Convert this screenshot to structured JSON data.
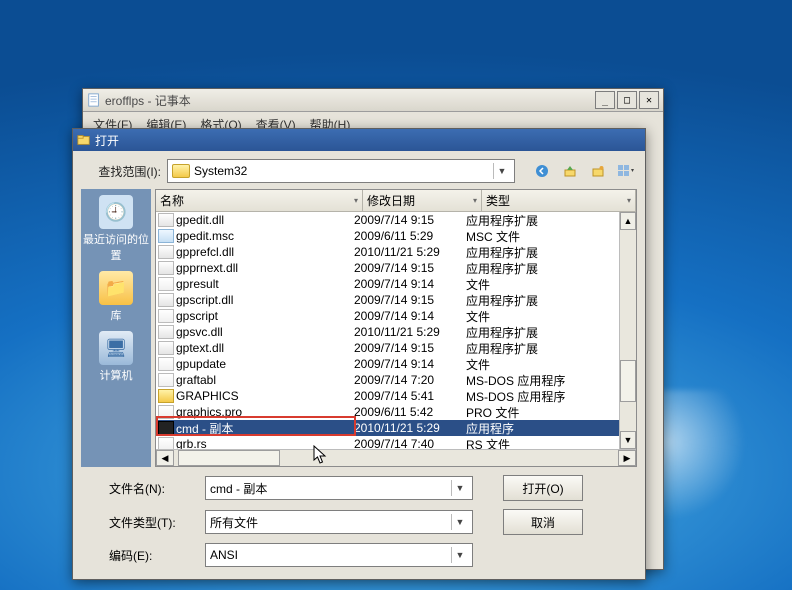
{
  "notepad": {
    "title": "erofflps - 记事本",
    "menu": {
      "file": "文件(F)",
      "edit": "编辑(E)",
      "format": "格式(O)",
      "view": "查看(V)",
      "help": "帮助(H)"
    }
  },
  "dialog": {
    "title": "打开",
    "lookin_label": "查找范围(I):",
    "lookin_value": "System32",
    "places": {
      "recent": "最近访问的位置",
      "libraries": "库",
      "computer": "计算机"
    },
    "columns": {
      "name": "名称",
      "date": "修改日期",
      "type": "类型"
    },
    "files": [
      {
        "icon": "dll",
        "name": "gpedit.dll",
        "date": "2009/7/14 9:15",
        "type": "应用程序扩展"
      },
      {
        "icon": "msc",
        "name": "gpedit.msc",
        "date": "2009/6/11 5:29",
        "type": "MSC 文件"
      },
      {
        "icon": "dll",
        "name": "gpprefcl.dll",
        "date": "2010/11/21 5:29",
        "type": "应用程序扩展"
      },
      {
        "icon": "dll",
        "name": "gpprnext.dll",
        "date": "2009/7/14 9:15",
        "type": "应用程序扩展"
      },
      {
        "icon": "doc",
        "name": "gpresult",
        "date": "2009/7/14 9:14",
        "type": "文件"
      },
      {
        "icon": "dll",
        "name": "gpscript.dll",
        "date": "2009/7/14 9:15",
        "type": "应用程序扩展"
      },
      {
        "icon": "doc",
        "name": "gpscript",
        "date": "2009/7/14 9:14",
        "type": "文件"
      },
      {
        "icon": "dll",
        "name": "gpsvc.dll",
        "date": "2010/11/21 5:29",
        "type": "应用程序扩展"
      },
      {
        "icon": "dll",
        "name": "gptext.dll",
        "date": "2009/7/14 9:15",
        "type": "应用程序扩展"
      },
      {
        "icon": "doc",
        "name": "gpupdate",
        "date": "2009/7/14 9:14",
        "type": "文件"
      },
      {
        "icon": "doc",
        "name": "graftabl",
        "date": "2009/7/14 7:20",
        "type": "MS-DOS 应用程序"
      },
      {
        "icon": "fld",
        "name": "GRAPHICS",
        "date": "2009/7/14 5:41",
        "type": "MS-DOS 应用程序"
      },
      {
        "icon": "doc",
        "name": "graphics.pro",
        "date": "2009/6/11 5:42",
        "type": "PRO 文件"
      },
      {
        "icon": "exe",
        "name": "cmd - 副本",
        "date": "2010/11/21 5:29",
        "type": "应用程序",
        "selected": true,
        "highlight": true
      },
      {
        "icon": "doc",
        "name": "grb.rs",
        "date": "2009/7/14 7:40",
        "type": "RS 文件"
      }
    ],
    "filename_label": "文件名(N):",
    "filename_value": "cmd - 副本",
    "filetype_label": "文件类型(T):",
    "filetype_value": "所有文件",
    "encoding_label": "编码(E):",
    "encoding_value": "ANSI",
    "open_btn": "打开(O)",
    "cancel_btn": "取消"
  }
}
